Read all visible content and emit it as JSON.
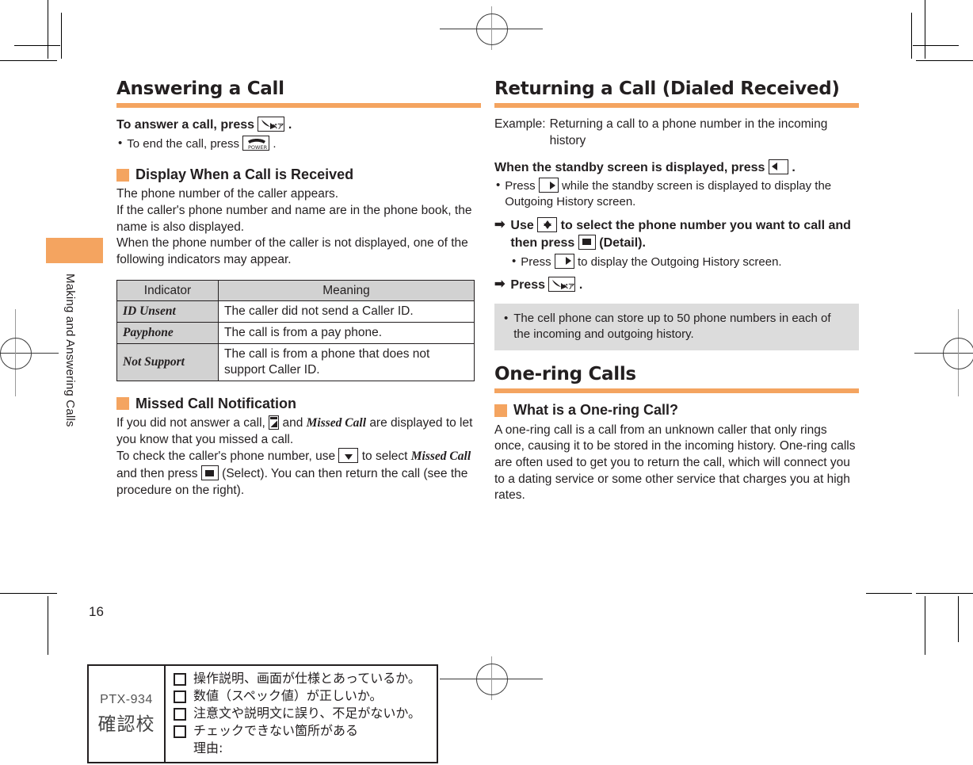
{
  "document": {
    "page_number": "16",
    "side_tab_label": "Making and Answering Calls"
  },
  "left_column": {
    "section_title": "Answering a Call",
    "lead_line_prefix": "To answer a call, press",
    "lead_line_suffix": ".",
    "lead_bullet_prefix": "To end the call, press",
    "lead_bullet_suffix": ".",
    "sub1": {
      "heading": "Display When a Call is Received",
      "para1": "The phone number of the caller appears.",
      "para2": "If the caller's phone number and name are in the phone book, the name is also displayed.",
      "para3": "When the phone number of the caller is not displayed, one of the following indicators may appear."
    },
    "table": {
      "headers": [
        "Indicator",
        "Meaning"
      ],
      "rows": [
        {
          "indicator": "ID Unsent",
          "meaning": "The caller did not send a Caller ID."
        },
        {
          "indicator": "Payphone",
          "meaning": "The call is from a pay phone."
        },
        {
          "indicator": "Not Support",
          "meaning": "The call is from a phone that does not support Caller ID."
        }
      ]
    },
    "sub2": {
      "heading": "Missed Call Notification",
      "line1_a": "If you did not answer a call,",
      "line1_b": "and",
      "line1_c": "Missed Call",
      "line1_d": "are displayed to let you know that you missed a call.",
      "line2_a": "To check the caller's phone number, use",
      "line2_b": "to select",
      "line2_c": "Missed Call",
      "line2_d": "and then press",
      "line2_e": "(Select). You can then return the call (see the procedure on the right)."
    }
  },
  "right_column": {
    "section_title": "Returning a Call (Dialed Received)",
    "example_label": "Example:",
    "example_text": "Returning a call to a phone number in the incoming history",
    "step1": {
      "text_prefix": "When the standby screen is displayed, press",
      "text_suffix": "."
    },
    "step1_bullet": {
      "prefix": "Press",
      "suffix": "while the standby screen is displayed to display the Outgoing History screen."
    },
    "step2": {
      "prefix": "Use",
      "middle": "to select the phone number you want to call and then press",
      "suffix": "(Detail)."
    },
    "step2_bullet": {
      "prefix": "Press",
      "suffix": "to display the Outgoing History screen."
    },
    "step3": {
      "prefix": "Press",
      "suffix": "."
    },
    "note": "The cell phone can store up to 50 phone numbers in each of the incoming and outgoing history.",
    "section2_title": "One-ring Calls",
    "sub1": {
      "heading": "What is a One-ring Call?",
      "para": "A one-ring call is a call from an unknown caller that only rings once, causing it to be stored in the incoming history. One-ring calls are often used to get you to return the call, which will connect you to a dating service or some other service that charges you at high rates."
    }
  },
  "keys": {
    "call_key_label": "ペア",
    "power_key_label": "POWER"
  },
  "proof_box": {
    "code": "PTX-934",
    "stage": "確認校",
    "items": [
      "操作説明、画面が仕様とあっているか。",
      "数値（スペック値）が正しいか。",
      "注意文や説明文に誤り、不足がないか。",
      "チェックできない箇所がある"
    ],
    "reason_label": "理由:"
  },
  "colors": {
    "accent": "#f4a460",
    "table_header_bg": "#d2d2d2",
    "note_bg": "#dcdcdc",
    "text": "#231f20"
  }
}
